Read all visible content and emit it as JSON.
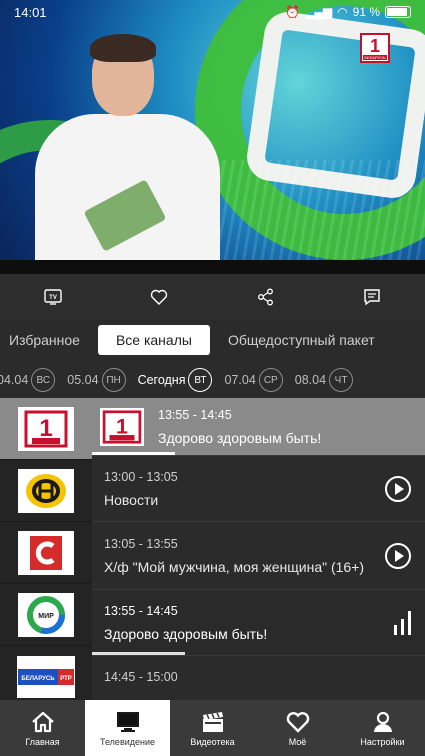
{
  "status": {
    "time": "14:01",
    "battery": "91 %"
  },
  "video": {
    "channel_logo_number": "1",
    "channel_logo_text": "БЕЛАРУСЬ"
  },
  "actions": [
    {
      "icon": "tv-guide-icon"
    },
    {
      "icon": "heart-icon"
    },
    {
      "icon": "share-icon"
    },
    {
      "icon": "subtitles-icon"
    }
  ],
  "categories": [
    "Избранное",
    "Все каналы",
    "Общедоступный пакет"
  ],
  "active_category": "Все каналы",
  "dates": [
    {
      "date": "04.04",
      "day": "ВС"
    },
    {
      "date": "05.04",
      "day": "ПН"
    },
    {
      "date": "Сегодня",
      "day": "ВТ"
    },
    {
      "date": "07.04",
      "day": "СР"
    },
    {
      "date": "08.04",
      "day": "ЧТ"
    }
  ],
  "channels": [
    {
      "logo": "Беларусь 1",
      "logo_text": "БЕЛАРУСЬ",
      "time": "13:55 - 14:45",
      "title": "Здорово здоровым быть!",
      "selected": true,
      "progress": 0.25
    },
    {
      "logo": "ОНТ",
      "time": "13:00 - 13:05",
      "title": "Новости",
      "action": "play"
    },
    {
      "logo": "Беларусь 3",
      "time": "13:05 - 13:55",
      "title": "Х/ф \"Мой мужчина, моя женщина\" (16+)",
      "action": "play"
    },
    {
      "logo": "Мир",
      "logo_text": "МИР",
      "time": "13:55 - 14:45",
      "title": "Здорово здоровым быть!",
      "action": "live",
      "progress": 0.28
    },
    {
      "logo": "Беларусь РТР",
      "logo_text": "БЕЛАРУСЬ РТР",
      "time": "14:45 - 15:00",
      "title": ""
    }
  ],
  "nav": [
    {
      "label": "Главная",
      "icon": "home-icon"
    },
    {
      "label": "Телевидение",
      "icon": "tv-icon",
      "active": true
    },
    {
      "label": "Видеотека",
      "icon": "clapperboard-icon"
    },
    {
      "label": "Моё",
      "icon": "heart-icon"
    },
    {
      "label": "Настройки",
      "icon": "person-icon"
    }
  ],
  "colors": {
    "accent_red": "#c8102e",
    "onto_yellow": "#f5c400",
    "selected_row": "#8a8a8a",
    "background": "#2b2b2b"
  }
}
